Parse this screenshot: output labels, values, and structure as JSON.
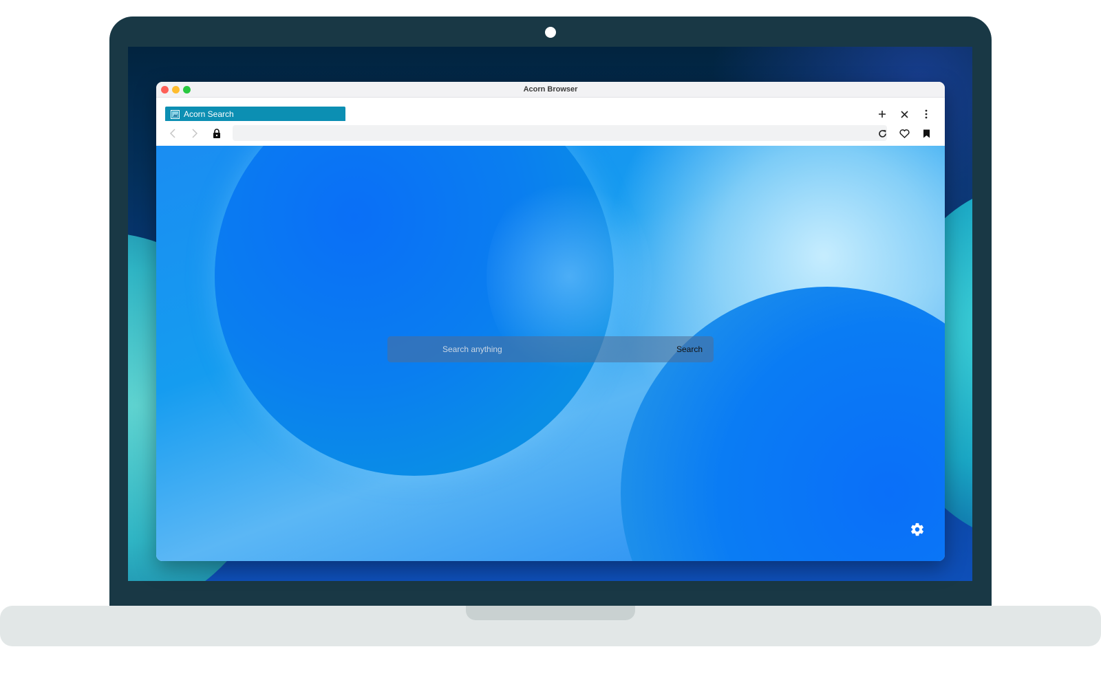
{
  "window": {
    "title": "Acorn Browser"
  },
  "tabs": [
    {
      "label": "Acorn Search",
      "active": true,
      "icon": "page-icon"
    }
  ],
  "tabbar_buttons": {
    "new_tab": "plus-icon",
    "close_tab": "close-icon",
    "menu": "more-vertical-icon"
  },
  "navbar": {
    "back": "chevron-left-icon",
    "forward": "chevron-right-icon",
    "lock": "lock-icon",
    "url": "",
    "reload": "reload-icon",
    "favorite": "heart-icon",
    "bookmark": "bookmark-icon"
  },
  "search": {
    "placeholder": "Search anything",
    "value": "",
    "button_label": "Search"
  },
  "settings": {
    "icon": "gear-icon"
  },
  "colors": {
    "tab_active": "#0c8fb3",
    "laptop_frame": "#193845",
    "page_primary": "#0a7ef0"
  }
}
